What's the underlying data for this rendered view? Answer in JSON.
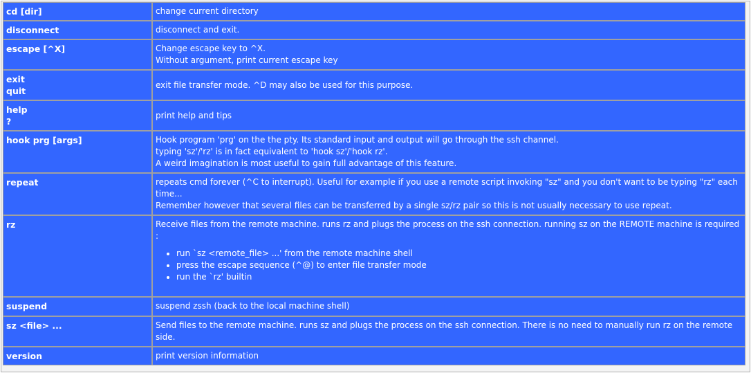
{
  "rows": [
    {
      "cmd": [
        "cd [dir]"
      ],
      "desc": [
        "change current directory"
      ]
    },
    {
      "cmd": [
        "disconnect"
      ],
      "desc": [
        "disconnect and exit."
      ]
    },
    {
      "cmd": [
        "escape [^X]"
      ],
      "desc": [
        "Change escape key to ^X.",
        "Without argument, print current escape key"
      ]
    },
    {
      "cmd": [
        "exit",
        "quit"
      ],
      "desc": [
        "exit file transfer mode. ^D may also be used for this purpose."
      ]
    },
    {
      "cmd": [
        "help",
        "?"
      ],
      "desc": [
        "print help and tips"
      ]
    },
    {
      "cmd": [
        "hook prg [args]"
      ],
      "desc": [
        "Hook program 'prg' on the the pty. Its standard input and output will go through the ssh channel.",
        "typing 'sz'/'rz' is in fact equivalent to 'hook sz'/'hook rz'.",
        "A weird imagination is most useful to gain full advantage of this feature."
      ]
    },
    {
      "cmd": [
        "repeat"
      ],
      "desc": [
        "repeats  cmd  forever  (^C to interrupt). Useful for example if you use a remote script  invoking \"sz\"  and  you don't want to be typing \"rz\" each time...",
        "Remember however that several files can be transferred by a single sz/rz pair so this is not usually necessary to use repeat."
      ]
    },
    {
      "cmd": [
        "rz"
      ],
      "desc": [
        "Receive files from the remote machine.  runs  rz and  plugs  the  process  on the ssh connection. running sz on the REMOTE machine is required :"
      ],
      "bullets": [
        "run `sz <remote_file> ...' from the  remote machine shell",
        "press  the  escape  sequence  (^@) to enter file transfer mode",
        "run the `rz' builtin"
      ]
    },
    {
      "cmd": [
        "suspend"
      ],
      "desc": [
        "suspend zssh (back to the local machine shell)"
      ]
    },
    {
      "cmd": [
        "sz <file> ..."
      ],
      "desc": [
        "Send  files  to  the remote machine. runs sz and plugs the process on the ssh connection. There is  no  need  to  manually  run rz on the remote side."
      ]
    },
    {
      "cmd": [
        "version"
      ],
      "desc": [
        "print version information"
      ]
    }
  ]
}
